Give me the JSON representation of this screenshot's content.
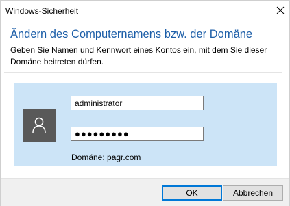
{
  "window": {
    "title": "Windows-Sicherheit"
  },
  "dialog": {
    "heading": "Ändern des Computernamens bzw. der Domäne",
    "description": "Geben Sie Namen und Kennwort eines Kontos ein, mit dem Sie dieser Domäne beitreten dürfen."
  },
  "credentials": {
    "username": "administrator",
    "password_masked": "●●●●●●●●●",
    "domain_text": "Domäne: pagr.com"
  },
  "buttons": {
    "ok": "OK",
    "cancel": "Abbrechen"
  },
  "colors": {
    "heading": "#1c5ea8",
    "panel": "#cce4f7",
    "avatar": "#595959",
    "accent": "#0078d7"
  },
  "icons": {
    "close": "close-icon",
    "user": "user-icon"
  }
}
